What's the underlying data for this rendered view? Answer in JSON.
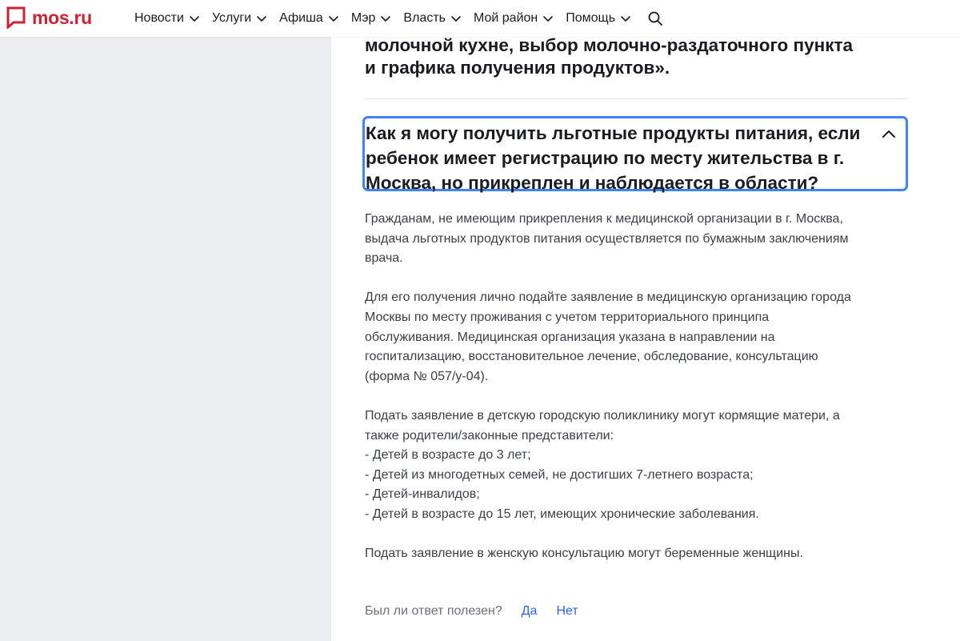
{
  "header": {
    "logo_text": "mos.ru",
    "brand_color": "#cc2233",
    "nav": [
      {
        "label": "Новости"
      },
      {
        "label": "Услуги"
      },
      {
        "label": "Афиша"
      },
      {
        "label": "Мэр"
      },
      {
        "label": "Власть"
      },
      {
        "label": "Мой район"
      },
      {
        "label": "Помощь"
      }
    ],
    "search_icon": "search-icon"
  },
  "prev_answer": {
    "lines": [
      "молочной кухне, выбор молочно-раздаточного пункта",
      "и графика получения продуктов»."
    ]
  },
  "question": {
    "lines": [
      "Как я могу получить льготные продукты питания, если",
      "ребенок имеет регистрацию по месту жительства в г.",
      "Москва, но прикреплен и наблюдается в области?"
    ],
    "expanded": true,
    "focus_color": "#3f83f8"
  },
  "answer": {
    "p1": [
      "Гражданам, не имеющим прикрепления к медицинской организации в г. Москва,",
      "выдача льготных продуктов питания осуществляется по бумажным заключениям",
      "врача."
    ],
    "p2": [
      "Для его получения лично подайте заявление в медицинскую организацию города",
      "Москвы по месту проживания с учетом территориального принципа",
      "обслуживания. Медицинская организация указана в направлении на",
      "госпитализацию, восстановительное лечение, обследование, консультацию",
      "(форма № 057/у-04)."
    ],
    "p3": [
      "Подать заявление в детскую городскую поликлинику могут кормящие матери, а",
      "также родители/законные представители:",
      "- Детей в возрасте до 3 лет;",
      "- Детей из многодетных семей, не достигших 7-летнего возраста;",
      "- Детей-инвалидов;",
      "- Детей в возрасте до 15 лет, имеющих хронические заболевания."
    ],
    "p4": [
      "Подать заявление в женскую консультацию могут беременные женщины."
    ]
  },
  "feedback": {
    "label": "Был ли ответ полезен?",
    "yes": "Да",
    "no": "Нет",
    "link_color": "#2b65ec"
  }
}
